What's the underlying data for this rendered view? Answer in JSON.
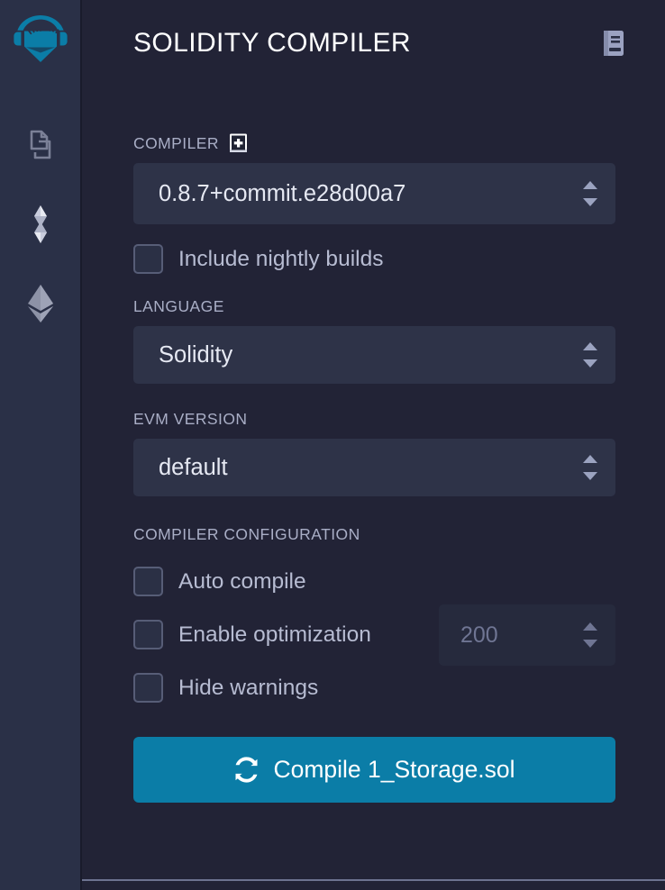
{
  "sidebar": {
    "items": [
      {
        "name": "remix-home-logo",
        "icon": "remix-logo-icon",
        "label": "Remix"
      },
      {
        "name": "file-explorers",
        "icon": "file-explorer-icon",
        "label": "File explorers"
      },
      {
        "name": "solidity-compiler",
        "icon": "solidity-logo-icon",
        "label": "Solidity compiler"
      },
      {
        "name": "deploy-run",
        "icon": "ethereum-logo-icon",
        "label": "Deploy & run transactions"
      }
    ]
  },
  "header": {
    "title": "SOLIDITY COMPILER",
    "doc_icon": "book-icon"
  },
  "compiler": {
    "label": "COMPILER",
    "add_icon": "plus-square-icon",
    "version": "0.8.7+commit.e28d00a7",
    "nightly": {
      "label": "Include nightly builds",
      "checked": false
    }
  },
  "language": {
    "label": "LANGUAGE",
    "value": "Solidity"
  },
  "evm": {
    "label": "EVM VERSION",
    "value": "default"
  },
  "configuration": {
    "label": "COMPILER CONFIGURATION",
    "auto_compile": {
      "label": "Auto compile",
      "checked": false
    },
    "enable_optimization": {
      "label": "Enable optimization",
      "checked": false
    },
    "runs": {
      "value": "",
      "placeholder": "200",
      "disabled": true
    },
    "hide_warnings": {
      "label": "Hide warnings",
      "checked": false
    }
  },
  "compile_button": {
    "label": "Compile 1_Storage.sol",
    "icon": "sync-icon"
  },
  "colors": {
    "accent": "#0b7da7",
    "panel_bg": "#222336",
    "rail_bg": "#2a3047",
    "field_bg": "#2e3348",
    "text_muted": "#a9aec6"
  }
}
